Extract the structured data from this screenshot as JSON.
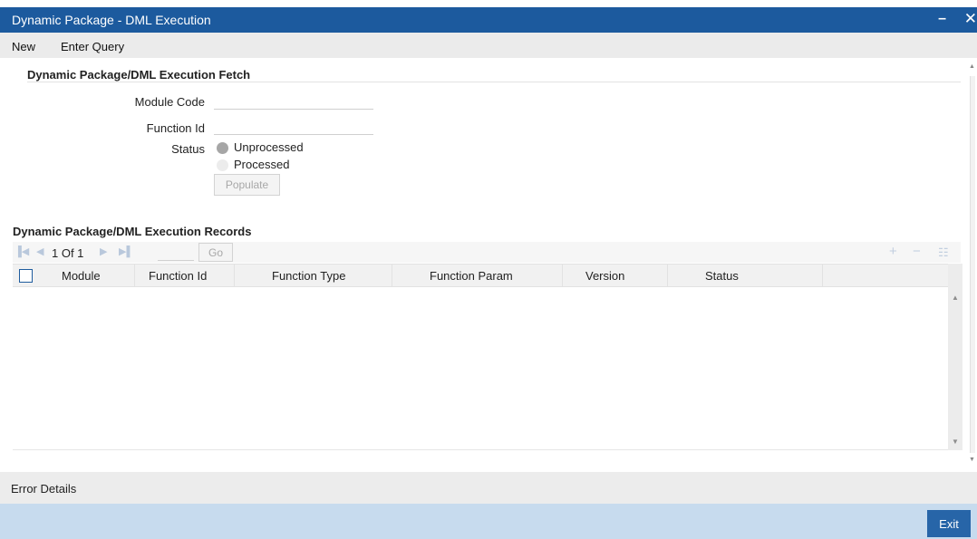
{
  "window": {
    "title": "Dynamic Package - DML Execution",
    "minimize_glyph": "–",
    "close_glyph": "✕"
  },
  "menu": {
    "items": [
      "New",
      "Enter Query"
    ]
  },
  "fetch_section": {
    "title": "Dynamic Package/DML Execution Fetch",
    "module_code_label": "Module Code",
    "module_code_value": "",
    "function_id_label": "Function Id",
    "function_id_value": "",
    "status_label": "Status",
    "status_options": [
      {
        "label": "Unprocessed",
        "selected": true
      },
      {
        "label": "Processed",
        "selected": false
      }
    ],
    "populate_label": "Populate"
  },
  "records_section": {
    "title": "Dynamic Package/DML Execution Records",
    "pager": {
      "text": "1 Of 1",
      "page_value": "",
      "go_label": "Go"
    },
    "columns": [
      "Module",
      "Function Id",
      "Function Type",
      "Function Param",
      "Version",
      "Status"
    ],
    "rows": []
  },
  "error_details": {
    "label": "Error Details"
  },
  "footer": {
    "exit_label": "Exit"
  },
  "colors": {
    "titlebar": "#1c5a9e",
    "footer": "#c7dbee",
    "exit_button": "#2765a8",
    "checkbox_border": "#1f5c9e"
  },
  "icons": {
    "minimize": "minimize-icon",
    "close": "close-icon",
    "first_page": "first-page-icon",
    "prev_page": "prev-page-icon",
    "next_page": "next-page-icon",
    "last_page": "last-page-icon",
    "add_row": "add-row-icon",
    "delete_row": "delete-row-icon",
    "single_view": "single-view-icon"
  }
}
